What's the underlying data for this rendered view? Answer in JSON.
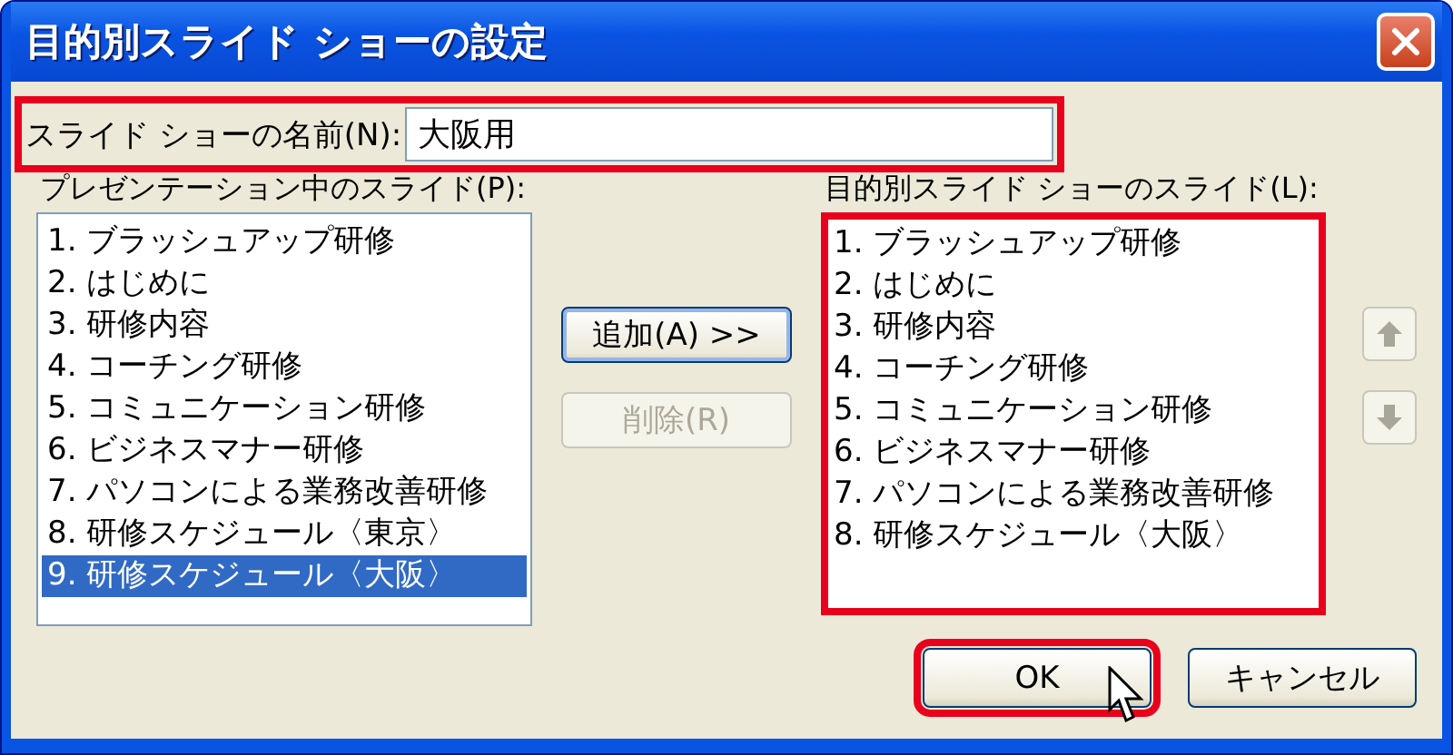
{
  "window": {
    "title": "目的別スライド ショーの設定"
  },
  "name_field": {
    "label": "スライド ショーの名前(N):",
    "value": "大阪用",
    "highlighted": true
  },
  "available_slides": {
    "label": "プレゼンテーション中のスライド(P):",
    "highlighted": false,
    "items": [
      {
        "text": "1. ブラッシュアップ研修",
        "selected": false
      },
      {
        "text": "2. はじめに",
        "selected": false
      },
      {
        "text": "3. 研修内容",
        "selected": false
      },
      {
        "text": "4. コーチング研修",
        "selected": false
      },
      {
        "text": "5. コミュニケーション研修",
        "selected": false
      },
      {
        "text": "6. ビジネスマナー研修",
        "selected": false
      },
      {
        "text": "7. パソコンによる業務改善研修",
        "selected": false
      },
      {
        "text": "8. 研修スケジュール〈東京〉",
        "selected": false
      },
      {
        "text": "9. 研修スケジュール〈大阪〉",
        "selected": true
      }
    ]
  },
  "move_buttons": [
    {
      "label": "追加(A) >>",
      "disabled": false
    },
    {
      "label": "削除(R)",
      "disabled": true
    }
  ],
  "custom_slides": {
    "label": "目的別スライド ショーのスライド(L):",
    "highlighted": true,
    "items": [
      {
        "text": "1. ブラッシュアップ研修",
        "selected": false
      },
      {
        "text": "2. はじめに",
        "selected": false
      },
      {
        "text": "3. 研修内容",
        "selected": false
      },
      {
        "text": "4. コーチング研修",
        "selected": false
      },
      {
        "text": "5. コミュニケーション研修",
        "selected": false
      },
      {
        "text": "6. ビジネスマナー研修",
        "selected": false
      },
      {
        "text": "7. パソコンによる業務改善研修",
        "selected": false
      },
      {
        "text": "8. 研修スケジュール〈大阪〉",
        "selected": false
      }
    ]
  },
  "order_buttons": [
    {
      "kind": "up",
      "disabled": true
    },
    {
      "kind": "down",
      "disabled": true
    }
  ],
  "dialog_buttons": [
    {
      "label": "OK",
      "highlighted": true
    },
    {
      "label": "キャンセル",
      "highlighted": false
    }
  ]
}
